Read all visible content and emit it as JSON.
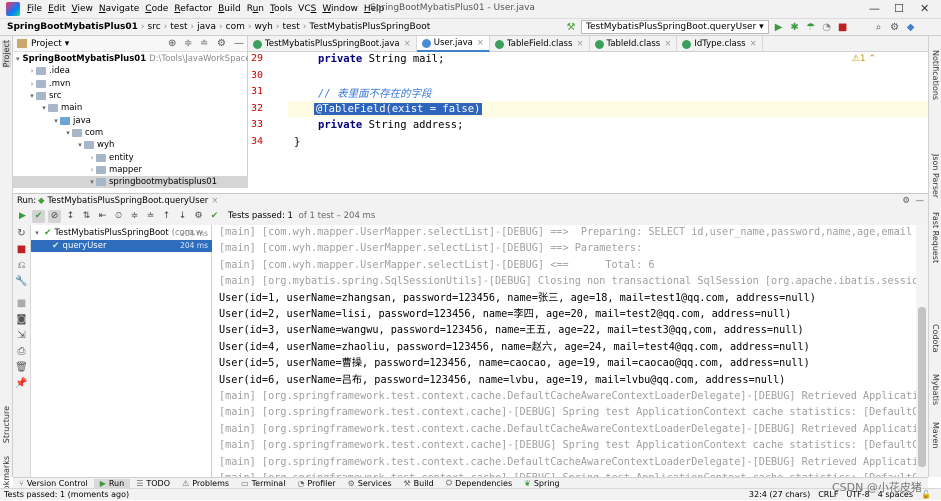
{
  "menubar": {
    "items": [
      {
        "label": "File",
        "u": "F"
      },
      {
        "label": "Edit",
        "u": "E"
      },
      {
        "label": "View",
        "u": "V"
      },
      {
        "label": "Navigate",
        "u": "N"
      },
      {
        "label": "Code",
        "u": "C"
      },
      {
        "label": "Refactor",
        "u": "R"
      },
      {
        "label": "Build",
        "u": "B"
      },
      {
        "label": "Run",
        "u": "u"
      },
      {
        "label": "Tools",
        "u": "T"
      },
      {
        "label": "VCS",
        "u": "S"
      },
      {
        "label": "Window",
        "u": "W"
      },
      {
        "label": "Help",
        "u": "H"
      }
    ],
    "window_title": "SpringBootMybatisPlus01 - User.java",
    "minimize": "—",
    "maximize": "☐",
    "close": "✕"
  },
  "navbar": {
    "crumbs": [
      "SpringBootMybatisPlus01",
      "src",
      "test",
      "java",
      "com",
      "wyh",
      "test",
      "TestMybatisPlusSpringBoot"
    ],
    "run_config": "TestMybatisPlusSpringBoot.queryUser",
    "run_config_arrow": "▾"
  },
  "left_stripe": {
    "project": "Project",
    "structure": "Structure",
    "bookmarks": "Bookmarks"
  },
  "right_stripe": {
    "notifications": "Notifications",
    "jsonparser": "Json Parser",
    "fastrequest": "Fast Request",
    "codota": "Codota",
    "mybatis": "Mybatis",
    "maven": "Maven"
  },
  "project": {
    "title": "Project",
    "title_arrow": "▾",
    "tree": [
      {
        "label": "SpringBootMybatisPlus01",
        "extra": "D:\\Tools\\JavaWorkSpace\\Spring",
        "indent": 0,
        "arrow": "▾",
        "kind": "mod",
        "bold": true
      },
      {
        "label": ".idea",
        "extra": "",
        "indent": 1,
        "arrow": "›",
        "kind": "folder"
      },
      {
        "label": ".mvn",
        "extra": "",
        "indent": 1,
        "arrow": "›",
        "kind": "folder"
      },
      {
        "label": "src",
        "extra": "",
        "indent": 1,
        "arrow": "▾",
        "kind": "folder"
      },
      {
        "label": "main",
        "extra": "",
        "indent": 2,
        "arrow": "▾",
        "kind": "folder"
      },
      {
        "label": "java",
        "extra": "",
        "indent": 3,
        "arrow": "▾",
        "kind": "src"
      },
      {
        "label": "com",
        "extra": "",
        "indent": 4,
        "arrow": "▾",
        "kind": "folder"
      },
      {
        "label": "wyh",
        "extra": "",
        "indent": 5,
        "arrow": "▾",
        "kind": "folder"
      },
      {
        "label": "entity",
        "extra": "",
        "indent": 6,
        "arrow": "›",
        "kind": "folder"
      },
      {
        "label": "mapper",
        "extra": "",
        "indent": 6,
        "arrow": "›",
        "kind": "folder"
      },
      {
        "label": "springbootmybatisplus01",
        "extra": "",
        "indent": 6,
        "arrow": "▾",
        "kind": "folder",
        "selected": true
      }
    ]
  },
  "editor": {
    "tabs": [
      {
        "label": "TestMybatisPlusSpringBoot.java",
        "color": "#3aa05c",
        "active": false
      },
      {
        "label": "User.java",
        "color": "#4a8bd6",
        "active": true
      },
      {
        "label": "TableField.class",
        "color": "#3aa05c",
        "active": false
      },
      {
        "label": "TableId.class",
        "color": "#3aa05c",
        "active": false
      },
      {
        "label": "IdType.class",
        "color": "#3aa05c",
        "active": false
      }
    ],
    "tab_close": "×",
    "lines": [
      {
        "num": "29",
        "text": "private String mail;"
      },
      {
        "num": "30",
        "text": ""
      },
      {
        "num": "31",
        "text": "// 表里面不存在的字段"
      },
      {
        "num": "32",
        "text": "@TableField(exist = false)"
      },
      {
        "num": "33",
        "text": "private String address;"
      },
      {
        "num": "34",
        "text": "}"
      }
    ],
    "warning": "⚠1 ⌃"
  },
  "run": {
    "label": "Run:",
    "tab": "TestMybatisPlusSpringBoot.queryUser",
    "tab_close": "×",
    "status_main": "Tests passed: 1",
    "status_dim": "of 1 test – 204 ms",
    "tree": [
      {
        "label": "TestMybatisPlusSpringBoot",
        "extra": "(com.w",
        "ms": "204 ms",
        "indent": 0,
        "selected": false
      },
      {
        "label": "queryUser",
        "extra": "",
        "ms": "204 ms",
        "indent": 1,
        "selected": true
      }
    ],
    "console": [
      {
        "text": "[main] [com.wyh.mapper.UserMapper.selectList]-[DEBUG] ==>  Preparing: SELECT id,user_name,password,name,age,email AS m",
        "grey": true
      },
      {
        "text": "[main] [com.wyh.mapper.UserMapper.selectList]-[DEBUG] ==> Parameters: ",
        "grey": true
      },
      {
        "text": "[main] [com.wyh.mapper.UserMapper.selectList]-[DEBUG] <==      Total: 6",
        "grey": true
      },
      {
        "text": "[main] [org.mybatis.spring.SqlSessionUtils]-[DEBUG] Closing non transactional SqlSession [org.apache.ibatis.session.de",
        "grey": true
      },
      {
        "text": "User(id=1, userName=zhangsan, password=123456, name=张三, age=18, mail=test1@qq.com, address=null)",
        "grey": false
      },
      {
        "text": "User(id=2, userName=lisi, password=123456, name=李四, age=20, mail=test2@qq.com, address=null)",
        "grey": false
      },
      {
        "text": "User(id=3, userName=wangwu, password=123456, name=王五, age=22, mail=test3@qq,com, address=null)",
        "grey": false
      },
      {
        "text": "User(id=4, userName=zhaoliu, password=123456, name=赵六, age=24, mail=test4@qq.com, address=null)",
        "grey": false
      },
      {
        "text": "User(id=5, userName=曹操, password=123456, name=caocao, age=19, mail=caocao@qq.com, address=null)",
        "grey": false
      },
      {
        "text": "User(id=6, userName=吕布, password=123456, name=lvbu, age=19, mail=lvbu@qq.com, address=null)",
        "grey": false
      },
      {
        "text": "[main] [org.springframework.test.context.cache.DefaultCacheAwareContextLoaderDelegate]-[DEBUG] Retrieved ApplicationCo",
        "grey": true
      },
      {
        "text": "[main] [org.springframework.test.context.cache]-[DEBUG] Spring test ApplicationContext cache statistics: [DefaultCont",
        "grey": true
      },
      {
        "text": "[main] [org.springframework.test.context.cache.DefaultCacheAwareContextLoaderDelegate]-[DEBUG] Retrieved ApplicationCo",
        "grey": true
      },
      {
        "text": "[main] [org.springframework.test.context.cache]-[DEBUG] Spring test ApplicationContext cache statistics: [DefaultCont",
        "grey": true
      },
      {
        "text": "[main] [org.springframework.test.context.cache.DefaultCacheAwareContextLoaderDelegate]-[DEBUG] Retrieved ApplicationCo",
        "grey": true
      },
      {
        "text": "[main] [org.springframework.test.context.cache]-[DEBUG] Spring test ApplicationContext cache statistics: [DefaultCont",
        "grey": true
      }
    ]
  },
  "bottom_tabs": [
    {
      "label": "Version Control",
      "icon": "branch-icon",
      "active": false
    },
    {
      "label": "Run",
      "icon": "run-icon",
      "active": true
    },
    {
      "label": "TODO",
      "icon": "list-icon",
      "active": false
    },
    {
      "label": "Problems",
      "icon": "problems-icon",
      "active": false
    },
    {
      "label": "Terminal",
      "icon": "terminal-icon",
      "active": false
    },
    {
      "label": "Profiler",
      "icon": "profiler-icon",
      "active": false
    },
    {
      "label": "Services",
      "icon": "services-icon",
      "active": false
    },
    {
      "label": "Build",
      "icon": "build-icon",
      "active": false
    },
    {
      "label": "Dependencies",
      "icon": "dependencies-icon",
      "active": false
    },
    {
      "label": "Spring",
      "icon": "spring-icon",
      "active": false
    }
  ],
  "statusbar": {
    "text": "Tests passed: 1 (moments ago)",
    "pos": "32:4 (27 chars)",
    "lf": "CRLF",
    "enc": "UTF-8",
    "indent": "4 spaces"
  },
  "watermark": "CSDN @小花皮猪"
}
